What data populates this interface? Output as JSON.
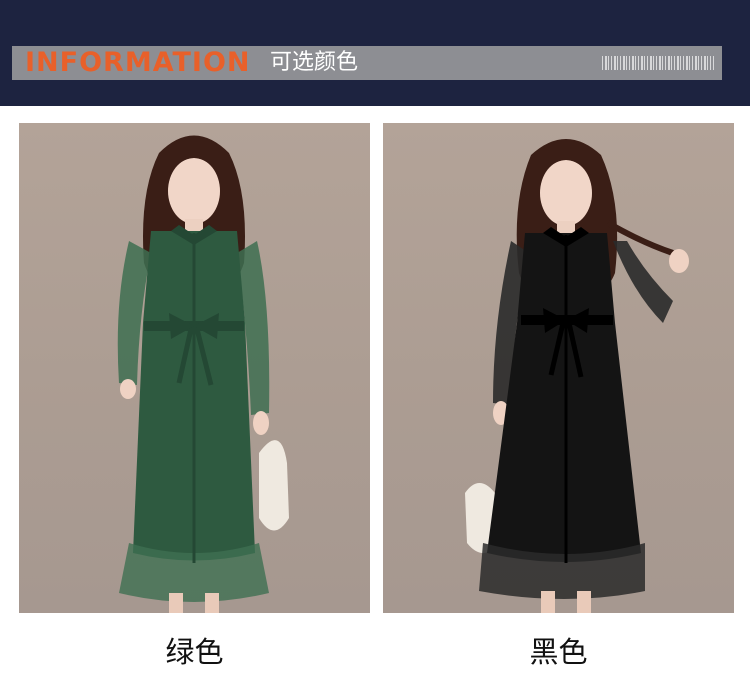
{
  "header": {
    "title_en": "INFORMATION",
    "title_cn": "可选颜色"
  },
  "colors": [
    {
      "label": "绿色",
      "dress_color": "#2e5a40",
      "sleeve_color": "#3e6f51"
    },
    {
      "label": "黑色",
      "dress_color": "#141414",
      "sleeve_color": "#2a2a2a"
    }
  ]
}
